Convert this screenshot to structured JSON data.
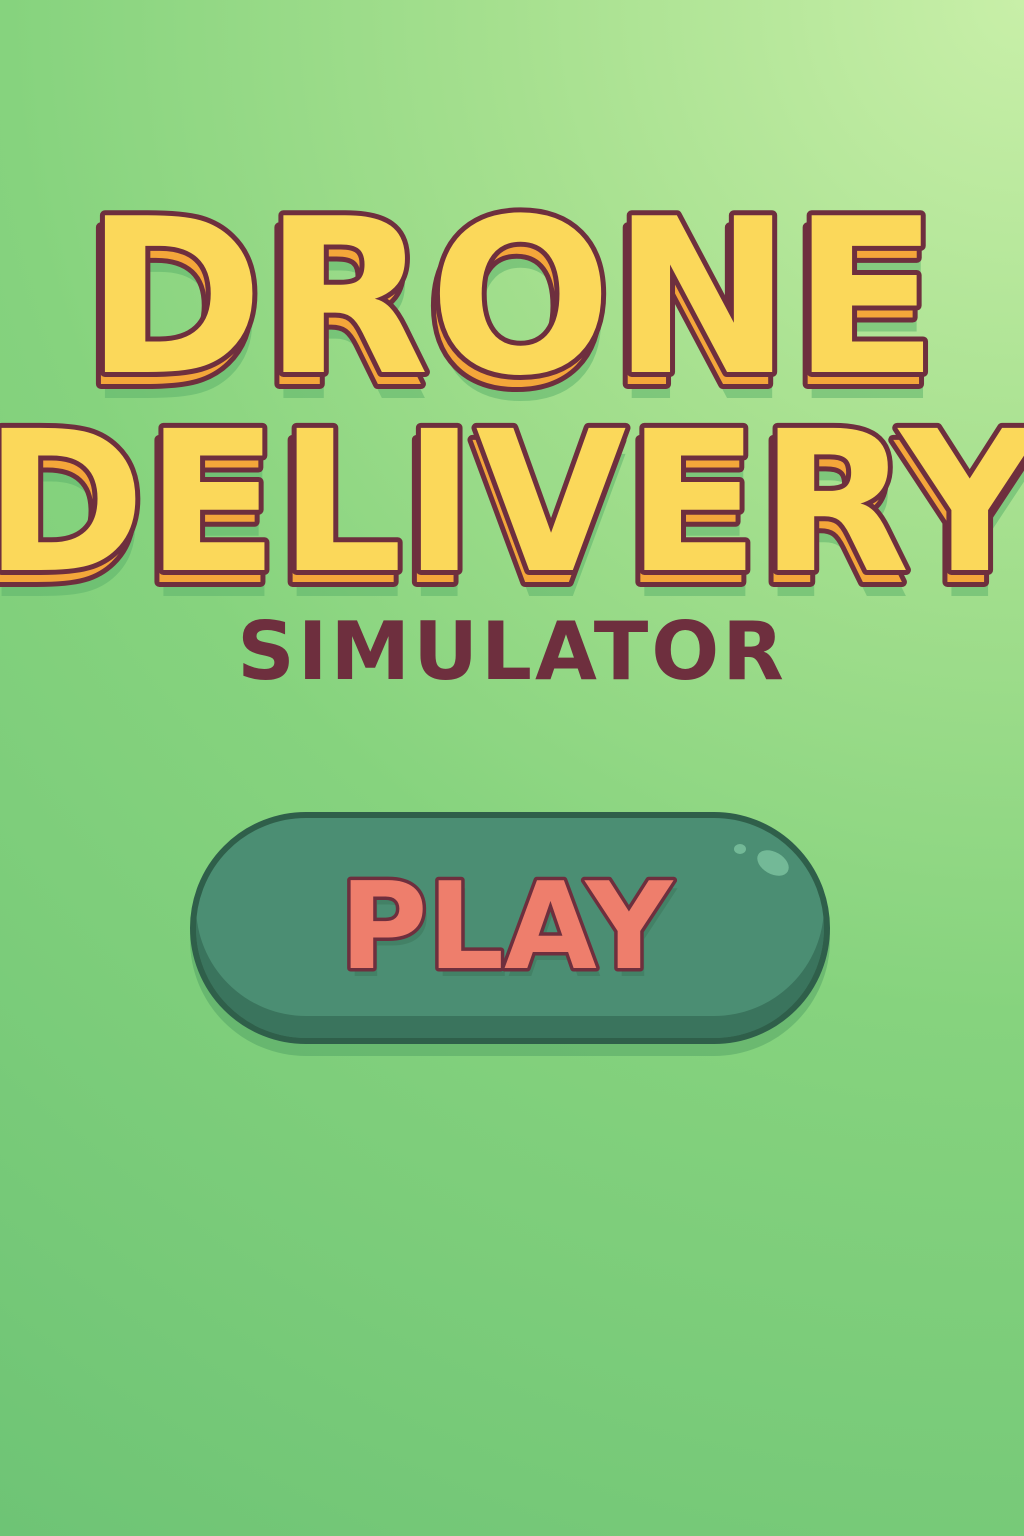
{
  "title": {
    "line1": "DRONE",
    "line2": "DELIVERY",
    "subtitle": "SIMULATOR"
  },
  "play_button": {
    "label": "PLAY"
  },
  "colors": {
    "background_light": "#c8efa8",
    "background_dark": "#6ec475",
    "title_fill": "#fbd85a",
    "title_shade": "#f4a63a",
    "outline": "#6e2f3e",
    "button_fill": "#4b8e73",
    "button_border": "#2f5f4a",
    "play_text": "#ee7e6c"
  }
}
